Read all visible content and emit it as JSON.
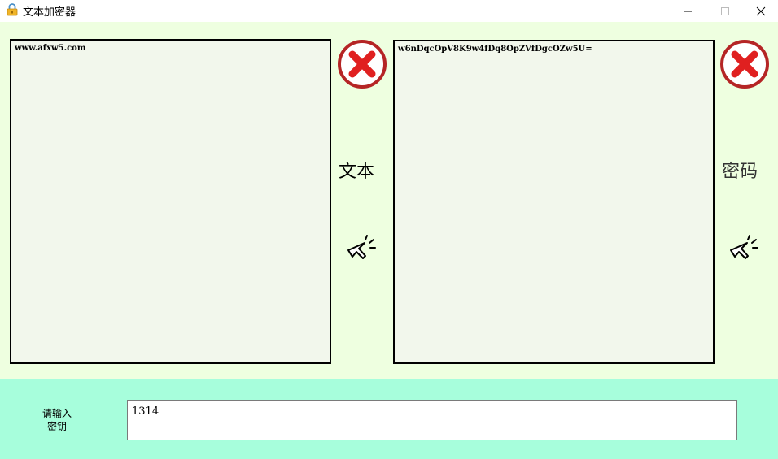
{
  "window": {
    "title": "文本加密器",
    "app_icon": "lock-icon",
    "controls": [
      "minimize-icon",
      "maximize-icon",
      "close-icon"
    ]
  },
  "left_panel": {
    "text": "www.afxw5.com",
    "label": "文本",
    "clear_icon": "red-x-circle-icon",
    "action_icon": "click-cursor-icon"
  },
  "right_panel": {
    "text": "w6nDqcOpV8K9w4fDq8OpZVfDgcOZw5U=",
    "label": "密码",
    "clear_icon": "red-x-circle-icon",
    "action_icon": "click-cursor-icon"
  },
  "key": {
    "label_line1": "请输入",
    "label_line2": "密钥",
    "value": "1314"
  },
  "colors": {
    "content_bg": "#eeffe0",
    "textbox_bg": "#f2f7ec",
    "bottom_bg": "#a7fedc",
    "clear_red": "#e02020",
    "clear_ring": "#b52525"
  }
}
